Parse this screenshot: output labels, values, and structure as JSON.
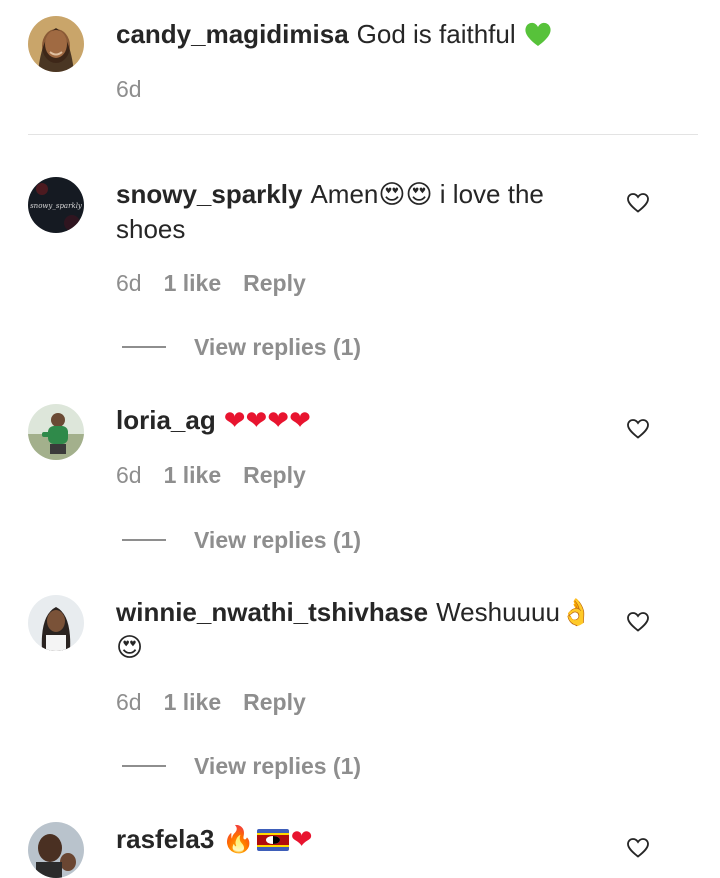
{
  "caption": {
    "username": "candy_magidimisa",
    "text": "God is faithful",
    "emoji": "💚",
    "time": "6d"
  },
  "comments": [
    {
      "username": "snowy_sparkly",
      "text_line1": "Amen",
      "emoji1": "😍😍",
      "text_rest": " i love the",
      "text_line2": "shoes",
      "time": "6d",
      "likes": "1 like",
      "reply_label": "Reply",
      "view_replies": "View replies (1)",
      "avatar_text": "snowy_sparkly"
    },
    {
      "username": "loria_ag",
      "emoji1": "❤❤❤❤",
      "time": "6d",
      "likes": "1 like",
      "reply_label": "Reply",
      "view_replies": "View replies (1)"
    },
    {
      "username": "winnie_nwathi_tshivhase",
      "text_line1": "Weshuuuu",
      "emoji1": "👌",
      "emoji2": "😍",
      "time": "6d",
      "likes": "1 like",
      "reply_label": "Reply",
      "view_replies": "View replies (1)"
    },
    {
      "username": "rasfela3",
      "emoji1": "🔥",
      "emoji2": "❤"
    }
  ],
  "colors": {
    "text": "#262626",
    "secondary": "#8e8e8e",
    "divider": "#e3e3e3",
    "heart_red": "#e8142f",
    "green_heart": "#57c23a"
  },
  "icons": {
    "like": "heart-outline-icon"
  }
}
